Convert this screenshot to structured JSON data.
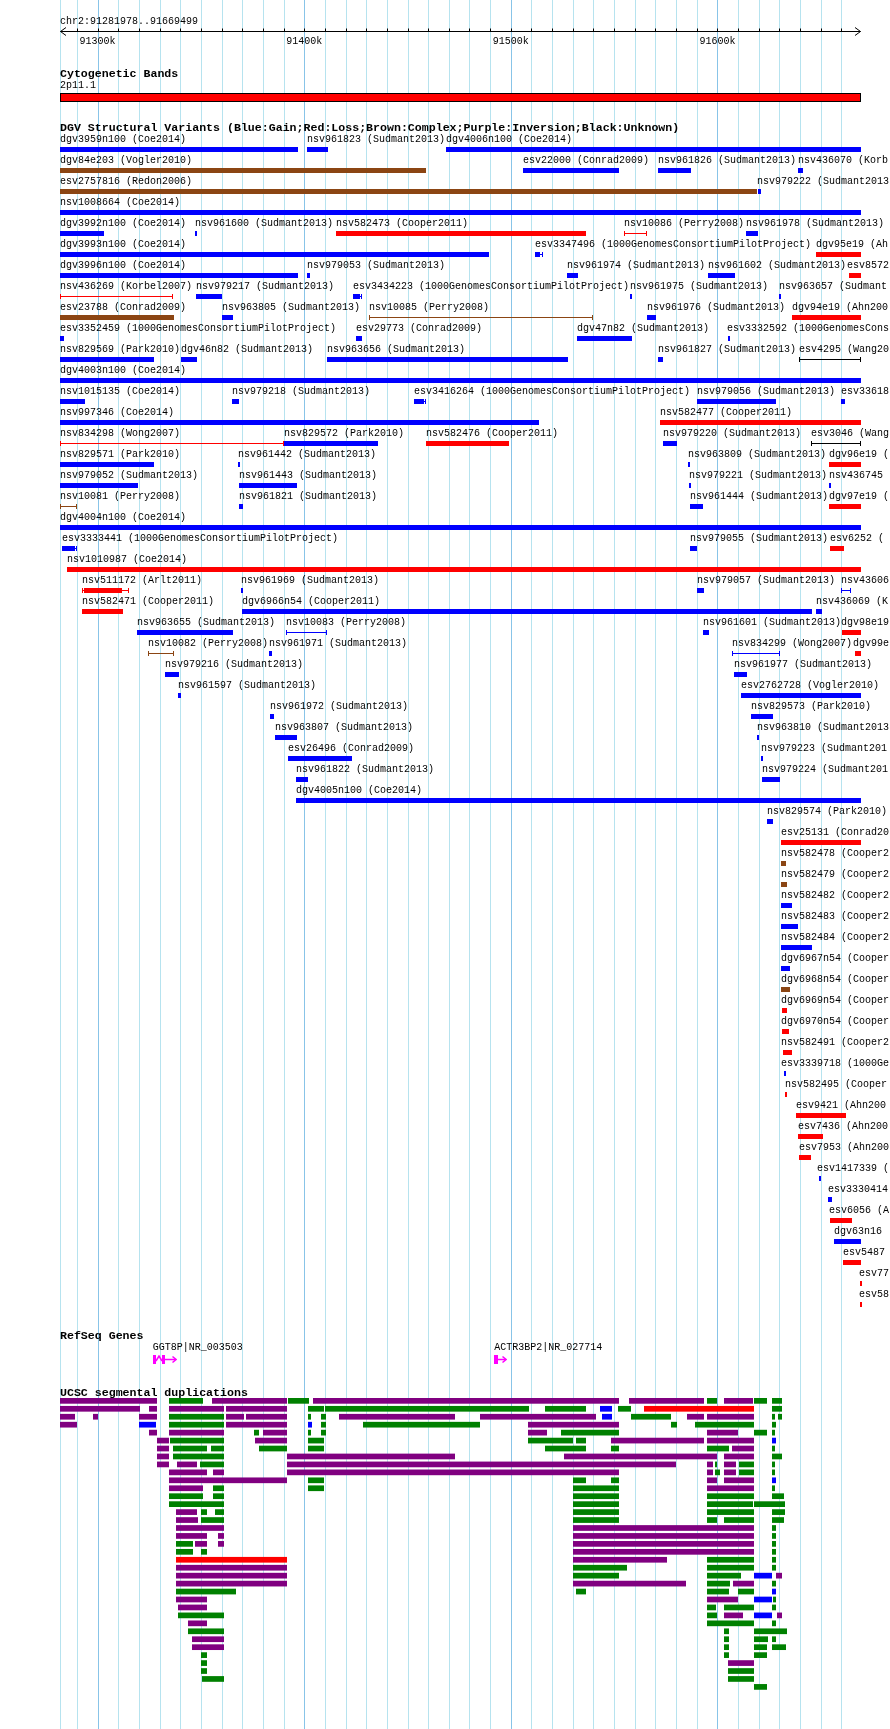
{
  "ruler": {
    "position": "chr2:91281978..91669499",
    "ticks": [
      "91300k",
      "91400k",
      "91500k",
      "91600k"
    ]
  },
  "cytogenetic_bands": {
    "title": "Cytogenetic Bands",
    "bands": [
      {
        "label": "2p11.1"
      }
    ]
  },
  "dgv_structural_variants": {
    "title": "DGV Structural Variants (Blue:Gain;Red:Loss;Brown:Complex;Purple:Inversion;Black:Unknown)",
    "rows": [
      {
        "features": [
          {
            "label": "dgv3959n100 (Coe2014)",
            "color": "#0000ff",
            "kind": "solid"
          },
          {
            "label": "nsv961823 (Sudmant2013)",
            "color": "#0000ff",
            "kind": "solid"
          },
          {
            "label": "dgv4006n100 (Coe2014)",
            "color": "#0000ff",
            "kind": "solid"
          }
        ]
      },
      {
        "features": [
          {
            "label": "dgv84e203 (Vogler2010)",
            "color": "#8b4513",
            "kind": "solid"
          },
          {
            "label": "esv22000 (Conrad2009)",
            "color": "#0000ff",
            "kind": "solid"
          },
          {
            "label": "nsv961826 (Sudmant2013)",
            "color": "#0000ff",
            "kind": "solid"
          },
          {
            "label": "nsv436070 (Korb",
            "color": "#0000ff",
            "kind": "mixed"
          }
        ]
      },
      {
        "features": [
          {
            "label": "esv2757816 (Redon2006)",
            "color": "#8b4513",
            "kind": "solid"
          },
          {
            "label": "nsv979222 (Sudmant2013",
            "color": "#0000ff",
            "kind": "solid"
          }
        ]
      },
      {
        "features": [
          {
            "label": "nsv1008664 (Coe2014)",
            "color": "#0000ff",
            "kind": "solid"
          }
        ]
      },
      {
        "features": [
          {
            "label": "dgv3992n100 (Coe2014)",
            "color": "#0000ff",
            "kind": "solid"
          },
          {
            "label": "nsv961600 (Sudmant2013)",
            "color": "#0000ff",
            "kind": "solid"
          },
          {
            "label": "nsv582473 (Cooper2011)",
            "color": "#ff0000",
            "kind": "solid"
          },
          {
            "label": "nsv10086 (Perry2008)",
            "color": "#ff0000",
            "kind": "interval"
          },
          {
            "label": "nsv961978 (Sudmant2013)",
            "color": "#0000ff",
            "kind": "solid"
          }
        ]
      },
      {
        "features": [
          {
            "label": "dgv3993n100 (Coe2014)",
            "color": "#0000ff",
            "kind": "solid"
          },
          {
            "label": "esv3347496 (1000GenomesConsortiumPilotProject)",
            "color": "#0000ff",
            "kind": "mixed"
          },
          {
            "label": "dgv95e19 (Ah",
            "color": "#ff0000",
            "kind": "solid"
          }
        ]
      },
      {
        "features": [
          {
            "label": "dgv3996n100 (Coe2014)",
            "color": "#0000ff",
            "kind": "solid"
          },
          {
            "label": "nsv979053 (Sudmant2013)",
            "color": "#0000ff",
            "kind": "solid"
          },
          {
            "label": "nsv961974 (Sudmant2013)",
            "color": "#0000ff",
            "kind": "solid"
          },
          {
            "label": "nsv961602 (Sudmant2013)",
            "color": "#0000ff",
            "kind": "solid"
          },
          {
            "label": "esv8572",
            "color": "#ff0000",
            "kind": "solid"
          }
        ]
      },
      {
        "features": [
          {
            "label": "nsv436269 (Korbel2007)",
            "color": "#ff0000",
            "kind": "interval"
          },
          {
            "label": "nsv979217 (Sudmant2013)",
            "color": "#0000ff",
            "kind": "solid"
          },
          {
            "label": "esv3434223 (1000GenomesConsortiumPilotProject)",
            "color": "#0000ff",
            "kind": "mixed"
          },
          {
            "label": "nsv961975 (Sudmant2013)",
            "color": "#0000ff",
            "kind": "solid"
          },
          {
            "label": "nsv963657 (Sudmant",
            "color": "#0000ff",
            "kind": "solid"
          }
        ]
      },
      {
        "features": [
          {
            "label": "esv23788 (Conrad2009)",
            "color": "#8b4513",
            "kind": "solid"
          },
          {
            "label": "nsv963805 (Sudmant2013)",
            "color": "#0000ff",
            "kind": "solid"
          },
          {
            "label": "nsv10085 (Perry2008)",
            "color": "#8b4513",
            "kind": "interval"
          },
          {
            "label": "nsv961976 (Sudmant2013)",
            "color": "#0000ff",
            "kind": "solid"
          },
          {
            "label": "dgv94e19 (Ahn200",
            "color": "#ff0000",
            "kind": "solid"
          }
        ]
      },
      {
        "features": [
          {
            "label": "esv3352459 (1000GenomesConsortiumPilotProject)",
            "color": "#0000ff",
            "kind": "mixed"
          },
          {
            "label": "esv29773 (Conrad2009)",
            "color": "#0000ff",
            "kind": "solid"
          },
          {
            "label": "dgv47n82 (Sudmant2013)",
            "color": "#0000ff",
            "kind": "solid"
          },
          {
            "label": "esv3332592 (1000GenomesCons",
            "color": "#0000ff",
            "kind": "solid"
          }
        ]
      },
      {
        "features": [
          {
            "label": "nsv829569 (Park2010)",
            "color": "#0000ff",
            "kind": "solid"
          },
          {
            "label": "dgv46n82 (Sudmant2013)",
            "color": "#0000ff",
            "kind": "solid"
          },
          {
            "label": "nsv963656 (Sudmant2013)",
            "color": "#0000ff",
            "kind": "solid"
          },
          {
            "label": "nsv961827 (Sudmant2013)",
            "color": "#0000ff",
            "kind": "solid"
          },
          {
            "label": "esv4295 (Wang20",
            "color": "#000000",
            "kind": "interval"
          }
        ]
      },
      {
        "features": [
          {
            "label": "dgv4003n100 (Coe2014)",
            "color": "#0000ff",
            "kind": "solid"
          }
        ]
      },
      {
        "features": [
          {
            "label": "nsv1015135 (Coe2014)",
            "color": "#0000ff",
            "kind": "solid"
          },
          {
            "label": "nsv979218 (Sudmant2013)",
            "color": "#0000ff",
            "kind": "solid"
          },
          {
            "label": "esv3416264 (1000GenomesConsortiumPilotProject)",
            "color": "#0000ff",
            "kind": "mixed"
          },
          {
            "label": "nsv979056 (Sudmant2013)",
            "color": "#0000ff",
            "kind": "solid"
          },
          {
            "label": "esv33618",
            "color": "#0000ff",
            "kind": "solid"
          }
        ]
      },
      {
        "features": [
          {
            "label": "nsv997346 (Coe2014)",
            "color": "#0000ff",
            "kind": "solid"
          },
          {
            "label": "nsv582477 (Cooper2011)",
            "color": "#ff0000",
            "kind": "solid"
          }
        ]
      },
      {
        "features": [
          {
            "label": "nsv834298 (Wong2007)",
            "color": "#ff0000",
            "kind": "interval"
          },
          {
            "label": "nsv829572 (Park2010)",
            "color": "#0000ff",
            "kind": "solid"
          },
          {
            "label": "nsv582476 (Cooper2011)",
            "color": "#ff0000",
            "kind": "solid"
          },
          {
            "label": "nsv979220 (Sudmant2013)",
            "color": "#0000ff",
            "kind": "solid"
          },
          {
            "label": "esv3046 (Wang",
            "color": "#000000",
            "kind": "interval"
          }
        ]
      },
      {
        "features": [
          {
            "label": "nsv829571 (Park2010)",
            "color": "#0000ff",
            "kind": "solid"
          },
          {
            "label": "nsv961442 (Sudmant2013)",
            "color": "#0000ff",
            "kind": "solid"
          },
          {
            "label": "nsv963809 (Sudmant2013)",
            "color": "#0000ff",
            "kind": "solid"
          },
          {
            "label": "dgv96e19 (",
            "color": "#ff0000",
            "kind": "solid"
          }
        ]
      },
      {
        "features": [
          {
            "label": "nsv979052 (Sudmant2013)",
            "color": "#0000ff",
            "kind": "solid"
          },
          {
            "label": "nsv961443 (Sudmant2013)",
            "color": "#0000ff",
            "kind": "solid"
          },
          {
            "label": "nsv979221 (Sudmant2013)",
            "color": "#0000ff",
            "kind": "solid"
          },
          {
            "label": "nsv436745",
            "color": "#0000ff",
            "kind": "solid"
          }
        ]
      },
      {
        "features": [
          {
            "label": "nsv10081 (Perry2008)",
            "color": "#8b4513",
            "kind": "interval"
          },
          {
            "label": "nsv961821 (Sudmant2013)",
            "color": "#0000ff",
            "kind": "solid"
          },
          {
            "label": "nsv961444 (Sudmant2013)",
            "color": "#0000ff",
            "kind": "solid"
          },
          {
            "label": "dgv97e19 (",
            "color": "#ff0000",
            "kind": "solid"
          }
        ]
      },
      {
        "features": [
          {
            "label": "dgv4004n100 (Coe2014)",
            "color": "#0000ff",
            "kind": "solid"
          }
        ]
      },
      {
        "features": [
          {
            "label": "esv3333441 (1000GenomesConsortiumPilotProject)",
            "color": "#0000ff",
            "kind": "mixed"
          },
          {
            "label": "nsv979055 (Sudmant2013)",
            "color": "#0000ff",
            "kind": "solid"
          },
          {
            "label": "esv6252 (",
            "color": "#ff0000",
            "kind": "solid"
          }
        ]
      },
      {
        "features": [
          {
            "label": "nsv1010987 (Coe2014)",
            "color": "#ff0000",
            "kind": "solid"
          }
        ]
      },
      {
        "features": [
          {
            "label": "nsv511172 (Arlt2011)",
            "color": "#ff0000",
            "kind": "mixed"
          },
          {
            "label": "nsv961969 (Sudmant2013)",
            "color": "#0000ff",
            "kind": "solid"
          },
          {
            "label": "nsv979057 (Sudmant2013)",
            "color": "#0000ff",
            "kind": "solid"
          },
          {
            "label": "nsv43606",
            "color": "#0000ff",
            "kind": "interval"
          }
        ]
      },
      {
        "features": [
          {
            "label": "nsv582471 (Cooper2011)",
            "color": "#ff0000",
            "kind": "solid"
          },
          {
            "label": "dgv6966n54 (Cooper2011)",
            "color": "#0000ff",
            "kind": "solid"
          },
          {
            "label": "nsv436069 (K",
            "color": "#0000ff",
            "kind": "mixed"
          }
        ]
      },
      {
        "features": [
          {
            "label": "nsv963655 (Sudmant2013)",
            "color": "#0000ff",
            "kind": "solid"
          },
          {
            "label": "nsv10083 (Perry2008)",
            "color": "#0000ff",
            "kind": "interval"
          },
          {
            "label": "nsv961601 (Sudmant2013)",
            "color": "#0000ff",
            "kind": "solid"
          },
          {
            "label": "dgv98e19",
            "color": "#ff0000",
            "kind": "solid"
          }
        ]
      },
      {
        "features": [
          {
            "label": "nsv10082 (Perry2008)",
            "color": "#8b4513",
            "kind": "interval"
          },
          {
            "label": "nsv961971 (Sudmant2013)",
            "color": "#0000ff",
            "kind": "solid"
          },
          {
            "label": "nsv834299 (Wong2007)",
            "color": "#0000ff",
            "kind": "interval"
          },
          {
            "label": "dgv99e",
            "color": "#ff0000",
            "kind": "solid"
          }
        ]
      },
      {
        "features": [
          {
            "label": "nsv979216 (Sudmant2013)",
            "color": "#0000ff",
            "kind": "solid"
          },
          {
            "label": "nsv961977 (Sudmant2013)",
            "color": "#0000ff",
            "kind": "solid"
          }
        ]
      },
      {
        "features": [
          {
            "label": "nsv961597 (Sudmant2013)",
            "color": "#0000ff",
            "kind": "solid"
          },
          {
            "label": "esv2762728 (Vogler2010)",
            "color": "#0000ff",
            "kind": "solid"
          }
        ]
      },
      {
        "features": [
          {
            "label": "nsv961972 (Sudmant2013)",
            "color": "#0000ff",
            "kind": "solid"
          },
          {
            "label": "nsv829573 (Park2010)",
            "color": "#0000ff",
            "kind": "solid"
          }
        ]
      },
      {
        "features": [
          {
            "label": "nsv963807 (Sudmant2013)",
            "color": "#0000ff",
            "kind": "solid"
          },
          {
            "label": "nsv963810 (Sudmant2013",
            "color": "#0000ff",
            "kind": "solid"
          }
        ]
      },
      {
        "features": [
          {
            "label": "esv26496 (Conrad2009)",
            "color": "#0000ff",
            "kind": "solid"
          },
          {
            "label": "nsv979223 (Sudmant201",
            "color": "#0000ff",
            "kind": "solid"
          }
        ]
      },
      {
        "features": [
          {
            "label": "nsv961822 (Sudmant2013)",
            "color": "#0000ff",
            "kind": "solid"
          },
          {
            "label": "nsv979224 (Sudmant201",
            "color": "#0000ff",
            "kind": "solid"
          }
        ]
      },
      {
        "features": [
          {
            "label": "dgv4005n100 (Coe2014)",
            "color": "#0000ff",
            "kind": "solid"
          }
        ]
      },
      {
        "features": [
          {
            "label": "nsv829574 (Park2010)",
            "color": "#0000ff",
            "kind": "solid"
          }
        ]
      },
      {
        "features": [
          {
            "label": "esv25131 (Conrad20",
            "color": "#ff0000",
            "kind": "solid"
          }
        ]
      },
      {
        "features": [
          {
            "label": "nsv582478 (Cooper2",
            "color": "#8b4513",
            "kind": "solid"
          }
        ]
      },
      {
        "features": [
          {
            "label": "nsv582479 (Cooper2",
            "color": "#8b4513",
            "kind": "solid"
          }
        ]
      },
      {
        "features": [
          {
            "label": "nsv582482 (Cooper2",
            "color": "#0000ff",
            "kind": "solid"
          }
        ]
      },
      {
        "features": [
          {
            "label": "nsv582483 (Cooper2",
            "color": "#0000ff",
            "kind": "solid"
          }
        ]
      },
      {
        "features": [
          {
            "label": "nsv582484 (Cooper2",
            "color": "#0000ff",
            "kind": "solid"
          }
        ]
      },
      {
        "features": [
          {
            "label": "dgv6967n54 (Cooper",
            "color": "#0000ff",
            "kind": "solid"
          }
        ]
      },
      {
        "features": [
          {
            "label": "dgv6968n54 (Cooper",
            "color": "#8b4513",
            "kind": "solid"
          }
        ]
      },
      {
        "features": [
          {
            "label": "dgv6969n54 (Cooper",
            "color": "#ff0000",
            "kind": "solid"
          }
        ]
      },
      {
        "features": [
          {
            "label": "dgv6970n54 (Cooper",
            "color": "#ff0000",
            "kind": "solid"
          }
        ]
      },
      {
        "features": [
          {
            "label": "nsv582491 (Cooper2",
            "color": "#ff0000",
            "kind": "solid"
          }
        ]
      },
      {
        "features": [
          {
            "label": "esv3339718 (1000Ge",
            "color": "#0000ff",
            "kind": "solid"
          }
        ]
      },
      {
        "features": [
          {
            "label": "nsv582495 (Cooper",
            "color": "#ff0000",
            "kind": "solid"
          }
        ]
      },
      {
        "features": [
          {
            "label": "esv9421 (Ahn200",
            "color": "#ff0000",
            "kind": "solid"
          }
        ]
      },
      {
        "features": [
          {
            "label": "esv7436 (Ahn200",
            "color": "#ff0000",
            "kind": "solid"
          }
        ]
      },
      {
        "features": [
          {
            "label": "esv7953 (Ahn200",
            "color": "#ff0000",
            "kind": "solid"
          }
        ]
      },
      {
        "features": [
          {
            "label": "esv1417339 (",
            "color": "#0000ff",
            "kind": "solid"
          }
        ]
      },
      {
        "features": [
          {
            "label": "esv3330414",
            "color": "#0000ff",
            "kind": "solid"
          }
        ]
      },
      {
        "features": [
          {
            "label": "esv6056 (A",
            "color": "#ff0000",
            "kind": "solid"
          }
        ]
      },
      {
        "features": [
          {
            "label": "dgv63n16",
            "color": "#0000ff",
            "kind": "solid"
          }
        ]
      },
      {
        "features": [
          {
            "label": "esv5487",
            "color": "#ff0000",
            "kind": "solid"
          }
        ]
      },
      {
        "features": [
          {
            "label": "esv77",
            "color": "#ff0000",
            "kind": "solid"
          }
        ]
      },
      {
        "features": [
          {
            "label": "esv58",
            "color": "#ff0000",
            "kind": "solid"
          }
        ]
      }
    ]
  },
  "refseq_genes": {
    "title": "RefSeq Genes",
    "genes": [
      {
        "label": "GGT8P|NR_003503"
      },
      {
        "label": "ACTR3BP2|NR_027714"
      }
    ]
  },
  "segmental_duplications": {
    "title": "UCSC segmental duplications",
    "groups": [
      {
        "color": "#800080"
      },
      {
        "color": "#008000"
      },
      {
        "color": "#ff0000"
      },
      {
        "color": "#0000ff"
      }
    ]
  }
}
